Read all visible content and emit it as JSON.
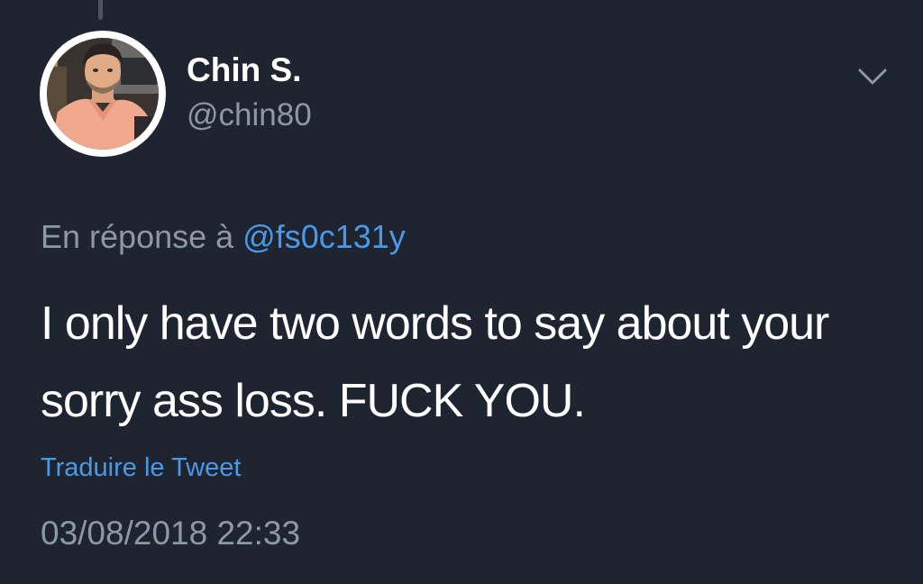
{
  "tweet": {
    "author": {
      "display_name": "Chin S.",
      "handle": "@chin80"
    },
    "reply": {
      "prefix": "En réponse à",
      "mention": "@fs0c131y"
    },
    "text": "I only have two words to say about your sorry ass loss. FUCK YOU.",
    "translate_label": "Traduire le Tweet",
    "timestamp": "03/08/2018 22:33"
  },
  "icons": {
    "menu": "chevron-down-icon",
    "avatar": "profile-photo"
  },
  "colors": {
    "background": "#1f2431",
    "primary_text": "#ffffff",
    "secondary_text": "#8b98a5",
    "accent": "#4a99e9"
  }
}
